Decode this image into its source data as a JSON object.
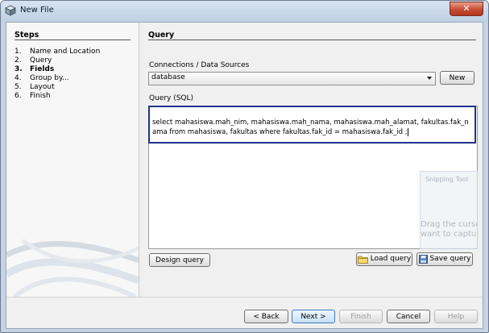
{
  "window": {
    "title": "New File",
    "close_glyph": "✕"
  },
  "steps": {
    "title": "Steps",
    "items": [
      {
        "num": "1.",
        "label": "Name and Location"
      },
      {
        "num": "2.",
        "label": "Query"
      },
      {
        "num": "3.",
        "label": "Fields"
      },
      {
        "num": "4.",
        "label": "Group by..."
      },
      {
        "num": "5.",
        "label": "Layout"
      },
      {
        "num": "6.",
        "label": "Finish"
      }
    ],
    "current_index": 3
  },
  "main": {
    "title": "Query",
    "connections_label": "Connections / Data Sources",
    "connection_value": "database",
    "new_label": "New",
    "sql_label": "Query (SQL)",
    "sql_text": "select mahasiswa.mah_nim, mahasiswa.mah_nama, mahasiswa.mah_alamat, fakultas.fak_nama from mahasiswa, fakultas where fakultas.fak_id = mahasiswa.fak_id ;",
    "design_label": "Design query",
    "load_label": "Load query",
    "save_label": "Save query"
  },
  "overlay": {
    "title": "Snipping Tool",
    "message_line1": "Drag the cursor",
    "message_line2": "want to capture"
  },
  "footer": {
    "back_label": "< Back",
    "next_label": "Next >",
    "finish_label": "Finish",
    "cancel_label": "Cancel",
    "help_label": "Help"
  },
  "colors": {
    "accent_border": "#24338c",
    "titlebar": "#c4d4e6",
    "close_button": "#c74b31"
  },
  "icons": [
    "cube-icon",
    "close-icon",
    "dropdown-arrow-icon",
    "folder-icon",
    "floppy-disk-icon"
  ]
}
